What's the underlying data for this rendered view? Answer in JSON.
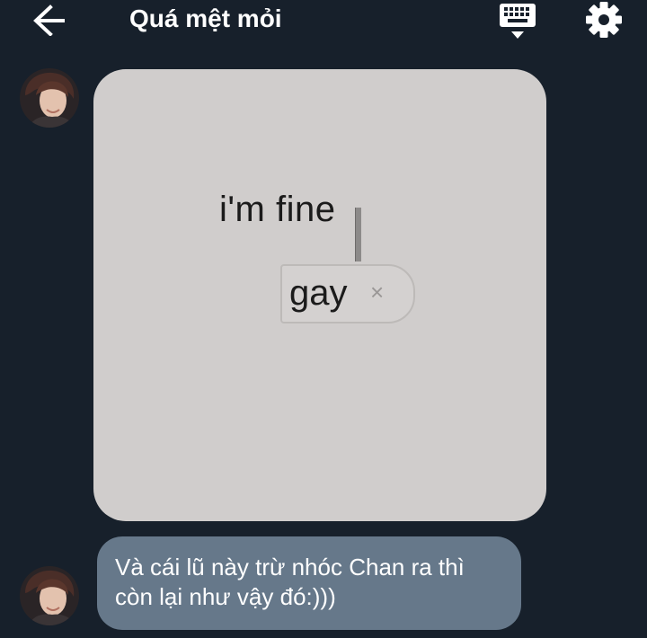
{
  "header": {
    "title": "Quá mệt mỏi",
    "back_icon": "arrow-left-icon",
    "keyboard_icon": "keyboard-icon",
    "settings_icon": "gear-icon"
  },
  "messages": [
    {
      "type": "image",
      "avatar": "avatar",
      "image": {
        "text_line": "i'm fine",
        "chip_word": "gay",
        "chip_close": "×"
      }
    },
    {
      "type": "text",
      "avatar": "avatar",
      "lines": [
        "Và cái lũ này trừ nhóc Chan ra thì",
        "còn lại như vậy đó:)))"
      ]
    }
  ],
  "colors": {
    "background": "#17202b",
    "bubble": "#66788a",
    "image_bg": "#d0cdcc",
    "icon": "#ffffff"
  }
}
